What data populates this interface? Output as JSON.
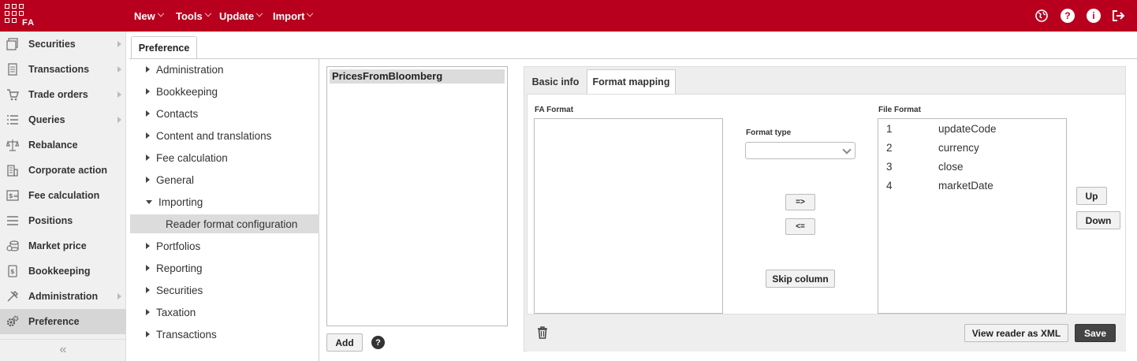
{
  "app": {
    "logo_text": "FA",
    "brand_color": "#b8001e"
  },
  "top_menu": [
    {
      "label": "New"
    },
    {
      "label": "Tools"
    },
    {
      "label": "Update"
    },
    {
      "label": "Import"
    }
  ],
  "top_icons": [
    "globe-icon",
    "help-icon",
    "info-icon",
    "logout-icon"
  ],
  "sidebar": {
    "items": [
      {
        "label": "Securities",
        "icon": "securities-icon",
        "has_submenu": true
      },
      {
        "label": "Transactions",
        "icon": "document-icon",
        "has_submenu": true
      },
      {
        "label": "Trade orders",
        "icon": "cart-icon",
        "has_submenu": true
      },
      {
        "label": "Queries",
        "icon": "list-icon",
        "has_submenu": true
      },
      {
        "label": "Rebalance",
        "icon": "scale-icon",
        "has_submenu": false
      },
      {
        "label": "Corporate action",
        "icon": "building-icon",
        "has_submenu": false
      },
      {
        "label": "Fee calculation",
        "icon": "fee-icon",
        "has_submenu": false
      },
      {
        "label": "Positions",
        "icon": "list-icon",
        "has_submenu": false
      },
      {
        "label": "Market price",
        "icon": "coins-icon",
        "has_submenu": false
      },
      {
        "label": "Bookkeeping",
        "icon": "book-icon",
        "has_submenu": false
      },
      {
        "label": "Administration",
        "icon": "tools-icon",
        "has_submenu": true
      },
      {
        "label": "Preference",
        "icon": "gears-icon",
        "has_submenu": false,
        "active": true
      }
    ],
    "collapse_label": "«"
  },
  "page_tab": "Preference",
  "tree": [
    {
      "label": "Administration",
      "expanded": false
    },
    {
      "label": "Bookkeeping",
      "expanded": false
    },
    {
      "label": "Contacts",
      "expanded": false
    },
    {
      "label": "Content and translations",
      "expanded": false
    },
    {
      "label": "Fee calculation",
      "expanded": false
    },
    {
      "label": "General",
      "expanded": false
    },
    {
      "label": "Importing",
      "expanded": true
    },
    {
      "label": "Reader format configuration",
      "child": true,
      "selected": true
    },
    {
      "label": "Portfolios",
      "expanded": false
    },
    {
      "label": "Reporting",
      "expanded": false
    },
    {
      "label": "Securities",
      "expanded": false
    },
    {
      "label": "Taxation",
      "expanded": false
    },
    {
      "label": "Transactions",
      "expanded": false
    }
  ],
  "readers": {
    "items": [
      "PricesFromBloomberg"
    ],
    "selected": "PricesFromBloomberg",
    "add_label": "Add",
    "help_label": "?"
  },
  "detail": {
    "tabs": [
      {
        "label": "Basic info",
        "active": false
      },
      {
        "label": "Format mapping",
        "active": true
      }
    ],
    "fa_format_label": "FA Format",
    "file_format_label": "File Format",
    "format_type_label": "Format type",
    "format_type_value": "",
    "add_arrow_label": "=>",
    "remove_arrow_label": "<=",
    "skip_column_label": "Skip column",
    "up_label": "Up",
    "down_label": "Down",
    "file_format_rows": [
      {
        "num": "1",
        "name": "updateCode"
      },
      {
        "num": "2",
        "name": "currency"
      },
      {
        "num": "3",
        "name": "close"
      },
      {
        "num": "4",
        "name": "marketDate"
      }
    ],
    "view_xml_label": "View reader as XML",
    "save_label": "Save"
  }
}
